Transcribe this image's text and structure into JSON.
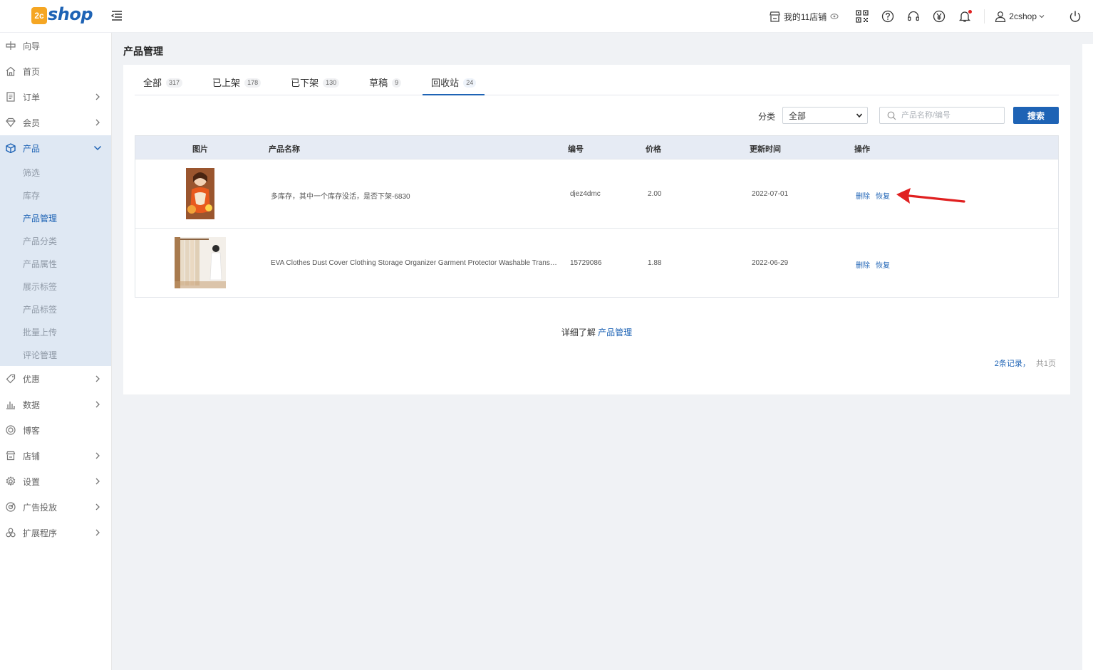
{
  "brand": {
    "badge": "2c",
    "text": "shop"
  },
  "header": {
    "store_label": "我的11店铺",
    "user_name": "2cshop"
  },
  "sidebar": {
    "items": [
      {
        "label": "向导"
      },
      {
        "label": "首页"
      },
      {
        "label": "订单"
      },
      {
        "label": "会员"
      },
      {
        "label": "产品"
      },
      {
        "label": "优惠"
      },
      {
        "label": "数据"
      },
      {
        "label": "博客"
      },
      {
        "label": "店铺"
      },
      {
        "label": "设置"
      },
      {
        "label": "广告投放"
      },
      {
        "label": "扩展程序"
      }
    ],
    "product_sub": [
      {
        "label": "筛选"
      },
      {
        "label": "库存"
      },
      {
        "label": "产品管理"
      },
      {
        "label": "产品分类"
      },
      {
        "label": "产品属性"
      },
      {
        "label": "展示标签"
      },
      {
        "label": "产品标签"
      },
      {
        "label": "批量上传"
      },
      {
        "label": "评论管理"
      }
    ]
  },
  "page": {
    "title": "产品管理"
  },
  "tabs": [
    {
      "label": "全部",
      "count": "317"
    },
    {
      "label": "已上架",
      "count": "178"
    },
    {
      "label": "已下架",
      "count": "130"
    },
    {
      "label": "草稿",
      "count": "9"
    },
    {
      "label": "回收站",
      "count": "24"
    }
  ],
  "filter": {
    "category_label": "分类",
    "category_value": "全部",
    "search_placeholder": "产品名称/编号",
    "search_button": "搜索"
  },
  "table": {
    "headers": {
      "image": "图片",
      "name": "产品名称",
      "code": "编号",
      "price": "价格",
      "updated": "更新时间",
      "actions": "操作"
    },
    "rows": [
      {
        "name": "多库存，其中一个库存没活，是否下架-6830",
        "code": "djez4dmc",
        "price": "2.00",
        "updated": "2022-07-01",
        "delete": "删除",
        "restore": "恢复"
      },
      {
        "name": "EVA Clothes Dust Cover Clothing Storage Organizer Garment Protector Washable Transparent Dust Bag",
        "code": "15729086",
        "price": "1.88",
        "updated": "2022-06-29",
        "delete": "删除",
        "restore": "恢复"
      }
    ]
  },
  "footer": {
    "text": "详细了解",
    "link": "产品管理"
  },
  "pager": {
    "records": "2条记录，",
    "pages": "共1页"
  },
  "colors": {
    "accent": "#1e63b5",
    "arrow": "#e02020",
    "brand_badge": "#f5a623"
  }
}
